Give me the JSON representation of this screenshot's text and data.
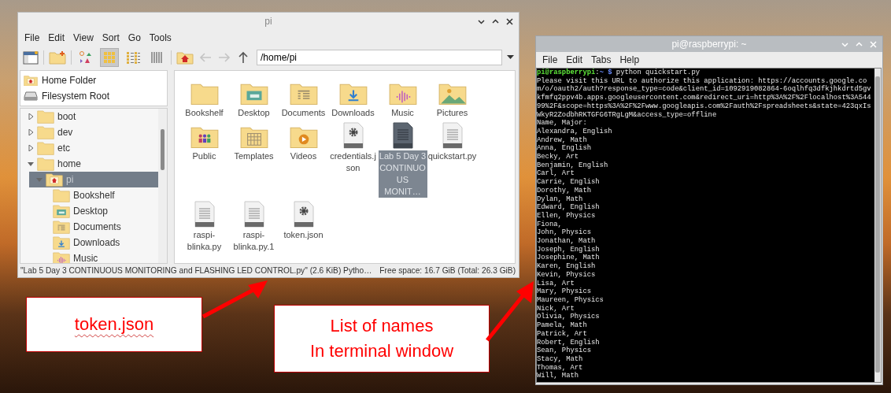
{
  "file_manager": {
    "title": "pi",
    "menu": [
      "File",
      "Edit",
      "View",
      "Sort",
      "Go",
      "Tools"
    ],
    "view_modes": [
      {
        "kind": "thumbnail",
        "selected": false
      },
      {
        "kind": "icons",
        "selected": true
      },
      {
        "kind": "list",
        "selected": false
      },
      {
        "kind": "compact",
        "selected": false
      }
    ],
    "navigation": [
      {
        "kind": "back",
        "disabled": true
      },
      {
        "kind": "forward",
        "disabled": true
      },
      {
        "kind": "up",
        "disabled": false
      }
    ],
    "path": "/home/pi",
    "places": [
      {
        "label": "Home Folder",
        "kind": "home"
      },
      {
        "label": "Filesystem Root",
        "kind": "drive"
      }
    ],
    "tree": [
      {
        "label": "boot",
        "kind": "folder",
        "expanded": false,
        "selected": false
      },
      {
        "label": "dev",
        "kind": "folder",
        "expanded": false,
        "selected": false
      },
      {
        "label": "etc",
        "kind": "folder",
        "expanded": false,
        "selected": false
      },
      {
        "label": "home",
        "kind": "folder",
        "expanded": true,
        "selected": false,
        "children": [
          {
            "label": "pi",
            "kind": "home",
            "expanded": true,
            "selected": true,
            "children": [
              {
                "label": "Bookshelf",
                "kind": "folder",
                "selected": false
              },
              {
                "label": "Desktop",
                "kind": "desktop",
                "selected": false
              },
              {
                "label": "Documents",
                "kind": "documents",
                "selected": false
              },
              {
                "label": "Downloads",
                "kind": "downloads",
                "selected": false
              },
              {
                "label": "Music",
                "kind": "music",
                "selected": false
              }
            ]
          }
        ]
      }
    ],
    "files": [
      {
        "label": "Bookshelf",
        "kind": "folder",
        "selected": false
      },
      {
        "label": "Desktop",
        "kind": "desktop",
        "selected": false
      },
      {
        "label": "Documents",
        "kind": "documents",
        "selected": false
      },
      {
        "label": "Downloads",
        "kind": "downloads",
        "selected": false
      },
      {
        "label": "Music",
        "kind": "music",
        "selected": false
      },
      {
        "label": "Pictures",
        "kind": "pictures",
        "selected": false
      },
      {
        "label": "Public",
        "kind": "public",
        "selected": false
      },
      {
        "label": "Templates",
        "kind": "templates",
        "selected": false
      },
      {
        "label": "Videos",
        "kind": "videos",
        "selected": false
      },
      {
        "label": "credentials.json",
        "kind": "config",
        "selected": false
      },
      {
        "label": "Lab 5 Day 3 CONTINUOUS MONIT…",
        "kind": "text",
        "selected": true
      },
      {
        "label": "quickstart.py",
        "kind": "text",
        "selected": false
      },
      {
        "label": "raspi-blinka.py",
        "kind": "text",
        "selected": false
      },
      {
        "label": "raspi-blinka.py.1",
        "kind": "text",
        "selected": false
      },
      {
        "label": "token.json",
        "kind": "config",
        "selected": false
      }
    ],
    "status_bar": {
      "selection": "\"Lab 5 Day 3 CONTINUOUS MONITORING and FLASHING LED CONTROL.py\" (2.6 KiB) Pytho…",
      "free_space": "Free space: 16.7 GiB (Total: 26.3 GiB)"
    }
  },
  "terminal": {
    "title": "pi@raspberrypi: ~",
    "menu": [
      "File",
      "Edit",
      "Tabs",
      "Help"
    ],
    "prompt": {
      "user_host": "pi@raspberrypi",
      "separator": ":",
      "path": "~",
      "symbol": "$",
      "command": "python quickstart.py"
    },
    "message": "Please visit this URL to authorize this application: https://accounts.google.com/o/oauth2/auth?response_type=code&client_id=1092919082864-6oqlhfq3dfkjhkdrtd5gvkfmfq2ppv4b.apps.googleusercontent.com&redirect_uri=http%3A%2F%2Flocalhost%3A54499%2F&scope=https%3A%2F%2Fwww.googleapis.com%2Fauth%2Fspreadsheets&state=423qxIsWkyR2ZodbhRKTGFG6TRgLgM&access_type=offline",
    "output": [
      "Name, Major:",
      "Alexandra, English",
      "Andrew, Math",
      "Anna, English",
      "Becky, Art",
      "Benjamin, English",
      "Carl, Art",
      "Carrie, English",
      "Dorothy, Math",
      "Dylan, Math",
      "Edward, English",
      "Ellen, Physics",
      "Fiona,",
      "John, Physics",
      "Jonathan, Math",
      "Joseph, English",
      "Josephine, Math",
      "Karen, English",
      "Kevin, Physics",
      "Lisa, Art",
      "Mary, Physics",
      "Maureen, Physics",
      "Nick, Art",
      "Olivia, Physics",
      "Pamela, Math",
      "Patrick, Art",
      "Robert, English",
      "Sean, Physics",
      "Stacy, Math",
      "Thomas, Art",
      "Will, Math"
    ]
  },
  "callouts": [
    {
      "text": "token.json",
      "spelling_flag": true
    },
    {
      "text": "List of names\nIn terminal window",
      "spelling_flag": false
    }
  ]
}
